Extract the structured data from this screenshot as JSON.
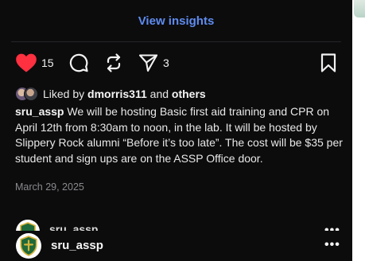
{
  "post": {
    "view_insights": "View insights",
    "like_count": "15",
    "share_count": "3",
    "liked_by_prefix": "Liked by",
    "liked_by_user": "dmorris311",
    "liked_by_joiner": "and",
    "liked_by_others": "others",
    "username": "sru_assp",
    "caption_text": "We will be hosting Basic first aid training and CPR on April 12th from 8:30am to noon, in the lab. It will be hosted by Slippery Rock alumni “Before it’s too late”. The cost will be $35 per student and sign ups are on the ASSP Office door.",
    "date": "March 29, 2025"
  },
  "next_post": {
    "username": "sru_assp",
    "more": "•••"
  },
  "header": {
    "username": "sru_assp",
    "more": "•••"
  },
  "icons": {
    "like": "heart-icon",
    "comment": "comment-icon",
    "repost": "repost-icon",
    "share": "paper-plane-icon",
    "save": "bookmark-icon"
  },
  "colors": {
    "background": "#0c0c0d",
    "insights_link": "#5f8cf0",
    "liked_heart": "#ff3040",
    "text": "#f2f2f2",
    "muted": "#8a8a8e",
    "shield_green": "#1f6a3a",
    "shield_gold": "#d6b33a"
  }
}
